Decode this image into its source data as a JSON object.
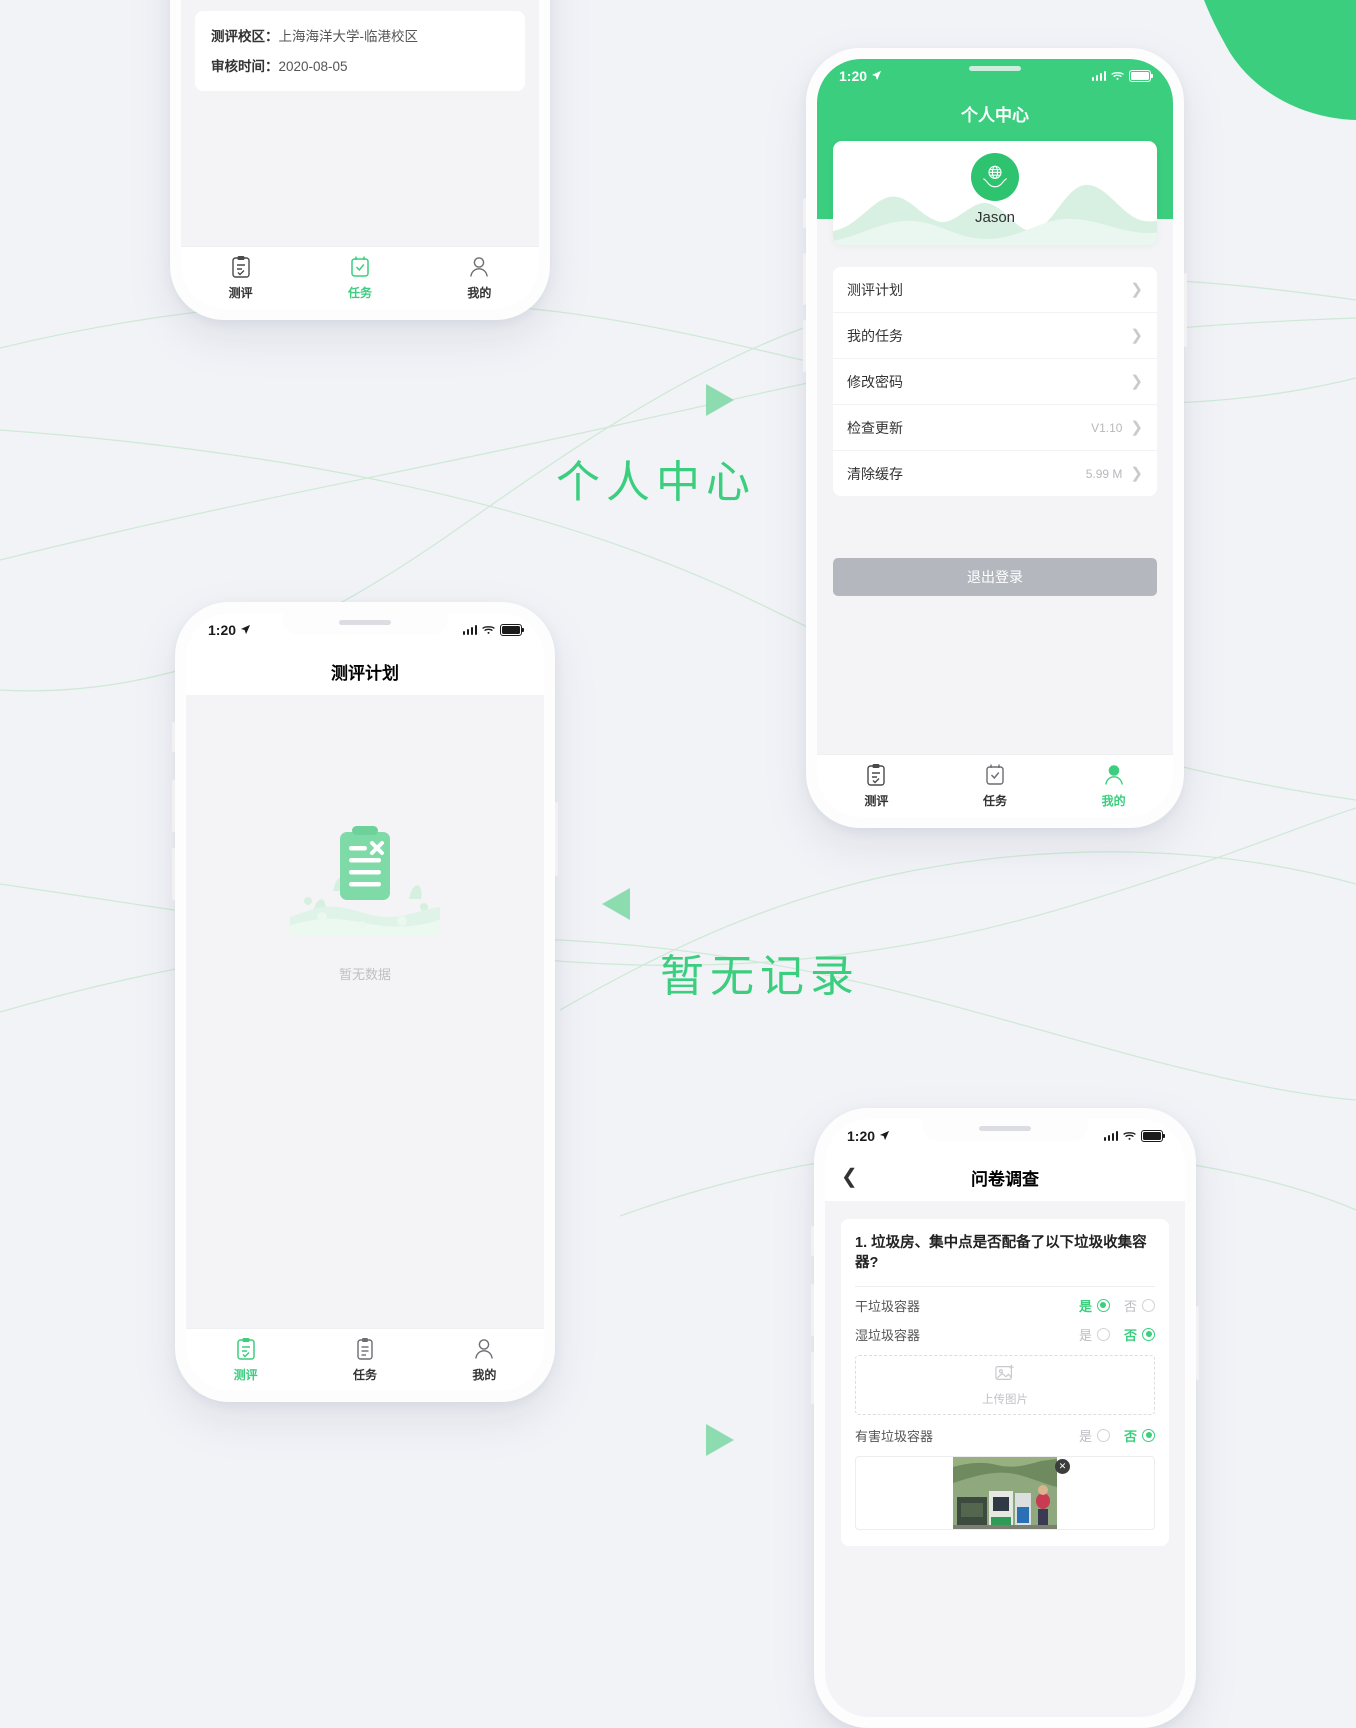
{
  "background": {
    "accent_green": "#3ACE7E",
    "light_green": "#8ddcb0",
    "page_bg": "#f2f3f7"
  },
  "annotations": [
    {
      "text": "个人中心",
      "id": "annotation-personal-center"
    },
    {
      "text": "暂无记录",
      "id": "annotation-no-records"
    }
  ],
  "phone_assessment_detail": {
    "card": {
      "campus_label": "测评校区：",
      "campus_value": "上海海洋大学-临港校区",
      "review_time_label": "审核时间：",
      "review_time_value": "2020-08-05"
    },
    "tabbar": [
      {
        "label": "测评",
        "icon": "clipboard-icon",
        "active": false
      },
      {
        "label": "任务",
        "icon": "calendar-check-icon",
        "active": true
      },
      {
        "label": "我的",
        "icon": "person-icon",
        "active": false
      }
    ]
  },
  "phone_personal_center": {
    "status": {
      "time": "1:20",
      "location_icon": "location-arrow-icon",
      "signal": "signal-bars-icon",
      "wifi": "wifi-icon",
      "battery": "battery-icon"
    },
    "title": "个人中心",
    "profile": {
      "name": "Jason",
      "avatar_icon": "globe-in-hands-icon"
    },
    "menu": [
      {
        "label": "测评计划",
        "value": ""
      },
      {
        "label": "我的任务",
        "value": ""
      },
      {
        "label": "修改密码",
        "value": ""
      },
      {
        "label": "检查更新",
        "value": "V1.10"
      },
      {
        "label": "清除缓存",
        "value": "5.99 M"
      }
    ],
    "logout_label": "退出登录",
    "tabbar": [
      {
        "label": "测评",
        "icon": "clipboard-icon",
        "active": false
      },
      {
        "label": "任务",
        "icon": "calendar-check-icon",
        "active": false
      },
      {
        "label": "我的",
        "icon": "person-icon",
        "active": true
      }
    ]
  },
  "phone_assessment_plan": {
    "status": {
      "time": "1:20"
    },
    "title": "测评计划",
    "empty_text": "暂无数据",
    "empty_icon": "clipboard-x-illustration",
    "tabbar": [
      {
        "label": "测评",
        "icon": "clipboard-icon",
        "active": true
      },
      {
        "label": "任务",
        "icon": "clipboard-lines-icon",
        "active": false
      },
      {
        "label": "我的",
        "icon": "person-icon",
        "active": false
      }
    ]
  },
  "phone_questionnaire": {
    "status": {
      "time": "1:20"
    },
    "back_icon": "chevron-left-icon",
    "title": "问卷调查",
    "question": {
      "text": "1. 垃圾房、集中点是否配备了以下垃圾收集容器?",
      "options_yes": "是",
      "options_no": "否",
      "rows": [
        {
          "label": "干垃圾容器",
          "answer": "yes",
          "attachment": "none"
        },
        {
          "label": "湿垃圾容器",
          "answer": "no",
          "attachment": "upload"
        },
        {
          "label": "有害垃圾容器",
          "answer": "no",
          "attachment": "photo"
        }
      ],
      "upload_label": "上传图片",
      "upload_icon": "image-plus-icon",
      "photo_remove_icon": "close-icon"
    }
  }
}
